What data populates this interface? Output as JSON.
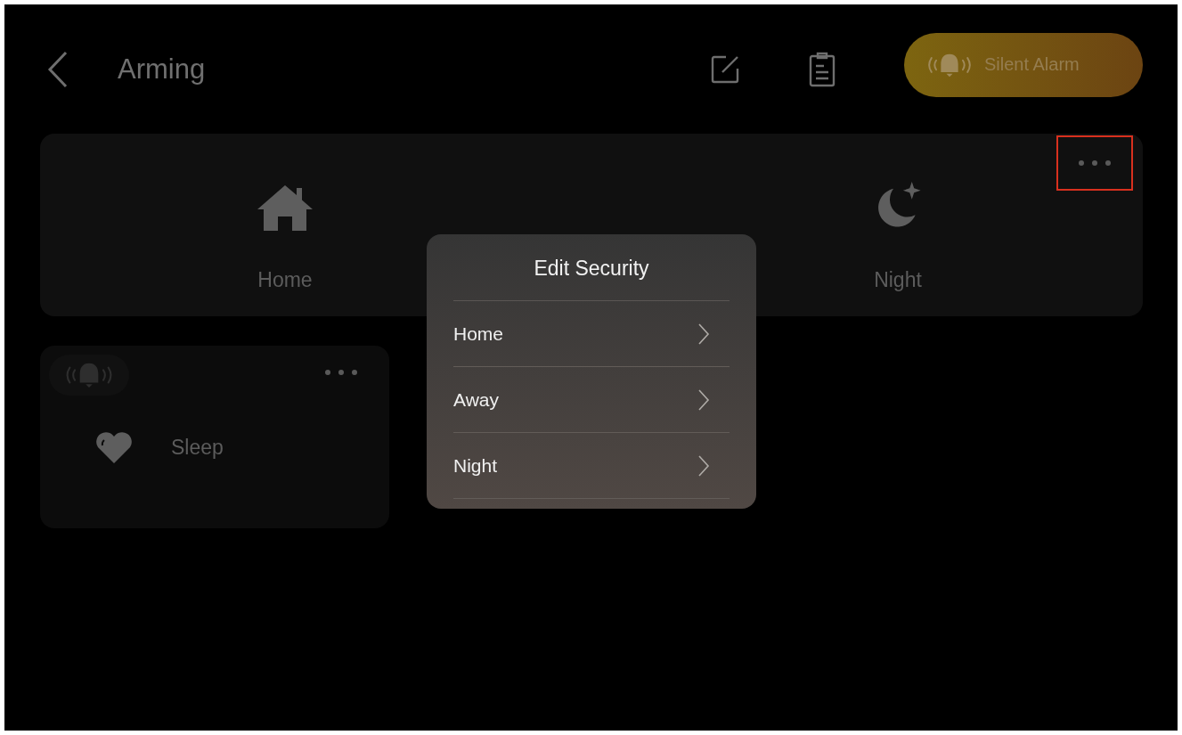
{
  "header": {
    "title": "Arming",
    "alarm_button": {
      "label": "Silent Alarm"
    }
  },
  "modes_card": {
    "more_highlighted": true,
    "modes": [
      {
        "kind": "home",
        "label": "Home"
      },
      {
        "kind": "away"
      },
      {
        "kind": "night",
        "label": "Night"
      }
    ]
  },
  "scene_cards": [
    {
      "kind": "sleep",
      "label": "Sleep"
    }
  ],
  "popup": {
    "title": "Edit Security",
    "items": [
      {
        "label": "Home"
      },
      {
        "label": "Away"
      },
      {
        "label": "Night"
      }
    ]
  }
}
